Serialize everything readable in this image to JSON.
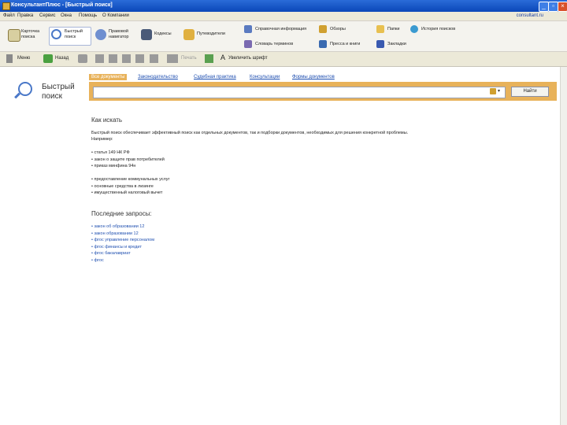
{
  "window": {
    "title": "КонсультантПлюс - [Быстрый поиск]"
  },
  "menu": {
    "items": [
      "Файл",
      "Правка",
      "Сервис",
      "Окна",
      "Помощь",
      "О Компании"
    ],
    "right_link": "consultant.ru"
  },
  "toolbar_main": {
    "big_buttons": [
      {
        "label_1": "Карточка",
        "label_2": "поиска"
      },
      {
        "label_1": "Быстрый",
        "label_2": "поиск"
      },
      {
        "label_1": "Правовой",
        "label_2": "навигатор"
      },
      {
        "label_1": "Кодексы",
        "label_2": ""
      },
      {
        "label_1": "Путеводители",
        "label_2": ""
      }
    ],
    "small_buttons": [
      "Справочная информация",
      "Обзоры",
      "Словарь терминов",
      "Пресса и книги",
      "Папки",
      "История поисков",
      "Закладки"
    ]
  },
  "toolbar_nav": {
    "menu_label": "Меню",
    "back_label": "Назад",
    "print_label": "Печать",
    "zoom_label": "Увеличить шрифт"
  },
  "panel": {
    "title_1": "Быстрый",
    "title_2": "поиск"
  },
  "tabs": [
    "Все документы",
    "Законодательство",
    "Судебная практика",
    "Консультации",
    "Формы документов"
  ],
  "search": {
    "button_label": "Найти",
    "placeholder": ""
  },
  "how_to": {
    "heading": "Как искать",
    "text_1": "Быстрый поиск обеспечивает эффективный поиск как отдельных документов, так и подборки документов, необходимых для решения конкретной проблемы.",
    "text_2": "Например:",
    "examples_1": [
      "статья 149 НК РФ",
      "закон о защите прав потребителей",
      "приказ минфина 94н"
    ],
    "examples_2": [
      "предоставление коммунальных услуг",
      "основные средства в лизинге",
      "имущественный налоговый вычет"
    ]
  },
  "recent": {
    "heading": "Последние запросы:",
    "items": [
      "закон об образовании 12",
      "закон образовании 12",
      "фгос управление персоналом",
      "фгос финансы и кредит",
      "фгос бакалавриат",
      "фгос"
    ]
  },
  "colors": {
    "accent": "#e8b25a",
    "link": "#1f4fb0"
  }
}
